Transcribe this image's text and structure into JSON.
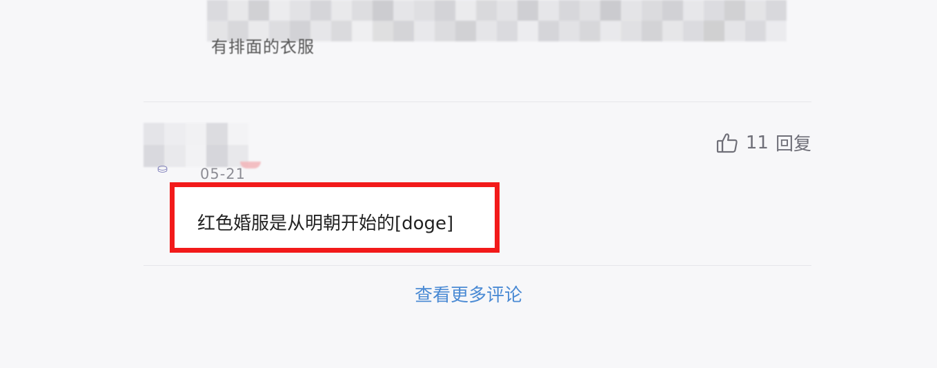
{
  "top_reply": {
    "partial_text": "有排面的衣服"
  },
  "comment": {
    "date": "05-21",
    "like_count": "11",
    "reply_label": "回复",
    "text": "红色婚服是从明朝开始的[doge]",
    "highlight_color": "#f21a1a"
  },
  "footer": {
    "view_more_label": "查看更多评论",
    "link_color": "#4a8ad4"
  },
  "icons": {
    "like": "thumbs-up-icon"
  }
}
